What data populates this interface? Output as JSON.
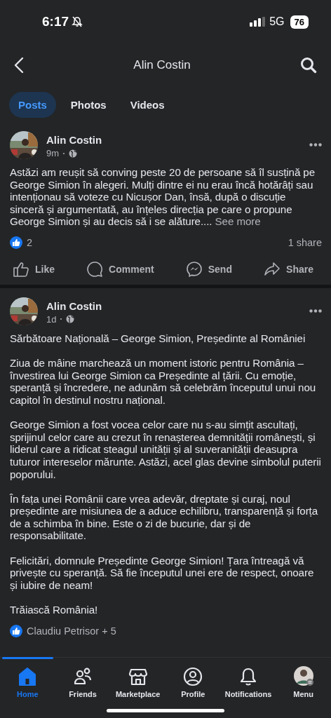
{
  "status_bar": {
    "time": "6:17",
    "network": "5G",
    "battery": "76"
  },
  "header": {
    "title": "Alin Costin"
  },
  "tabs": [
    {
      "label": "Posts",
      "selected": true
    },
    {
      "label": "Photos",
      "selected": false
    },
    {
      "label": "Videos",
      "selected": false
    }
  ],
  "posts": [
    {
      "author": "Alin Costin",
      "time": "9m",
      "paragraphs": [
        "Astăzi am reușit să conving peste 20 de persoane să îl susțină pe George Simion în alegeri. Mulți dintre ei nu erau încă hotărâți sau intenționau să voteze cu Nicușor Dan, însă, după o discuție sinceră și argumentată, au înțeles direcția pe care o propune George Simion și au decis să i se alăture...."
      ],
      "see_more": "See more",
      "reactions": "2",
      "shares": "1 share",
      "actions": [
        "Like",
        "Comment",
        "Send",
        "Share"
      ]
    },
    {
      "author": "Alin Costin",
      "time": "1d",
      "paragraphs": [
        "Sărbătoare Națională – George Simion, Președinte al României",
        "Ziua de mâine marchează un moment istoric pentru România – învestirea lui George Simion ca Președinte al țării. Cu emoție, speranță și încredere, ne adunăm să celebrăm începutul unui nou capitol în destinul nostru național.",
        "George Simion a fost vocea celor care nu s-au simțit ascultați, sprijinul celor care au crezut în renașterea demnității românești, și liderul care a ridicat steagul unității și al suveranității deasupra tuturor intereselor mărunte. Astăzi, acel glas devine simbolul puterii poporului.",
        "În fața unei Românii care vrea adevăr, dreptate și curaj, noul președinte are misiunea de a aduce echilibru, transparență și forța de a schimba în bine. Este o zi de bucurie, dar și de responsabilitate.",
        "Felicitări, domnule Președinte George Simion! Țara întreagă vă privește cu speranță. Să fie începutul unei ere de respect, onoare și iubire de neam!",
        "Trăiască România!"
      ],
      "reactions": "Claudiu Petrisor + 5"
    }
  ],
  "nav": [
    {
      "kind": "home",
      "label": "Home",
      "selected": true
    },
    {
      "kind": "friends",
      "label": "Friends",
      "selected": false
    },
    {
      "kind": "marketplace",
      "label": "Marketplace",
      "selected": false
    },
    {
      "kind": "profile",
      "label": "Profile",
      "selected": false
    },
    {
      "kind": "notifications",
      "label": "Notifications",
      "selected": false
    },
    {
      "kind": "menu",
      "label": "Menu",
      "selected": false
    }
  ]
}
